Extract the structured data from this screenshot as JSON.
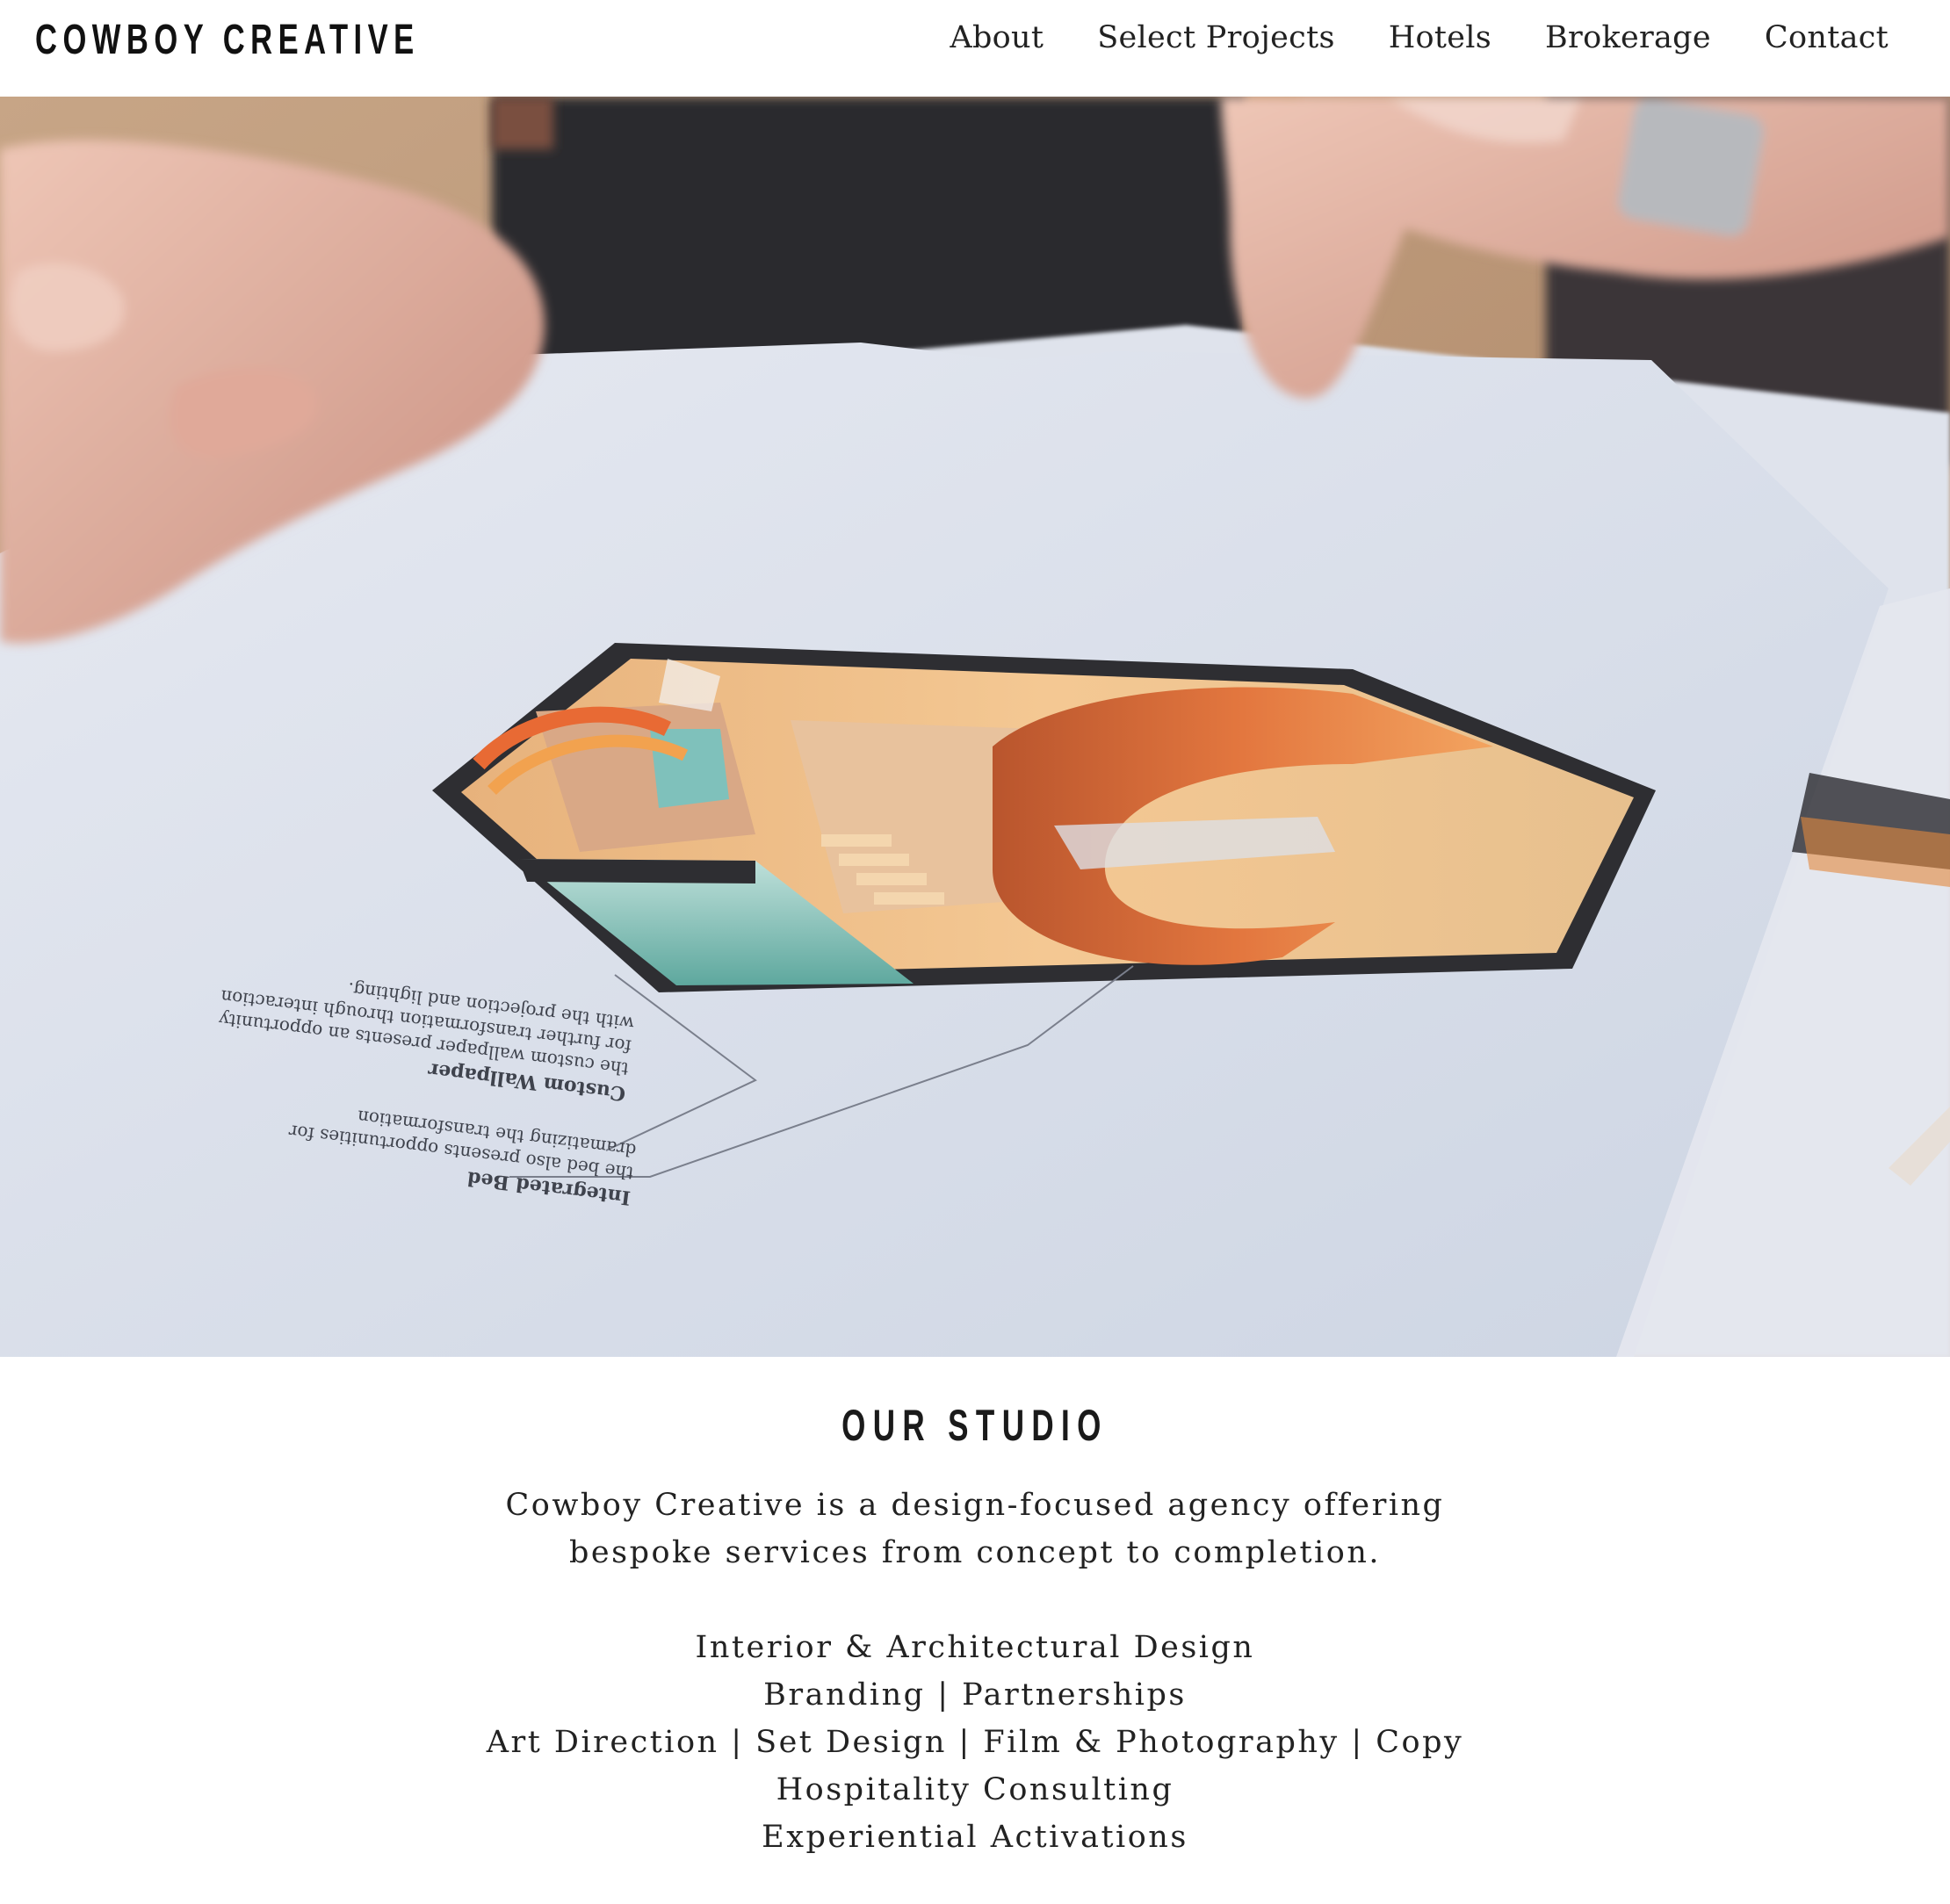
{
  "brand": {
    "name": "COWBOY CREATIVE"
  },
  "nav": {
    "items": [
      {
        "label": "About"
      },
      {
        "label": "Select Projects"
      },
      {
        "label": "Hotels"
      },
      {
        "label": "Brokerage"
      },
      {
        "label": "Contact"
      }
    ]
  },
  "hero": {
    "callouts": {
      "integrated_bed_title": "Integrated Bed",
      "integrated_bed_line1": "the bed also presents opportunities for",
      "integrated_bed_line2": "dramatizing the transformation",
      "wallpaper_title": "Custom Wallpaper",
      "wallpaper_line1": "the custom wallpaper presents an opportunity",
      "wallpaper_line2": "for further transformation through interaction",
      "wallpaper_line3": "with the projection and lighting."
    }
  },
  "studio": {
    "heading": "OUR STUDIO",
    "intro_line1": "Cowboy Creative is a design-focused agency offering",
    "intro_line2": "bespoke services from concept to completion.",
    "services": [
      "Interior & Architectural Design",
      "Branding | Partnerships",
      "Art Direction | Set Design | Film & Photography | Copy",
      "Hospitality Consulting",
      "Experiential Activations"
    ]
  }
}
